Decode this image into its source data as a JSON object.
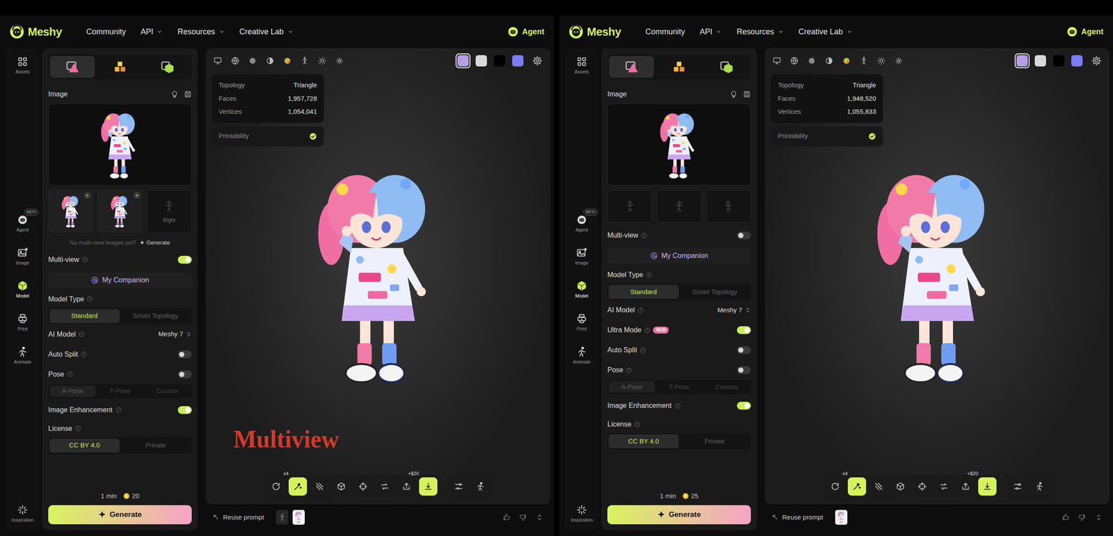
{
  "apps": [
    {
      "nav": {
        "logo": "Meshy",
        "links": [
          {
            "label": "Community",
            "dropdown": false
          },
          {
            "label": "API",
            "dropdown": true
          },
          {
            "label": "Resources",
            "dropdown": true
          },
          {
            "label": "Creative Lab",
            "dropdown": true
          }
        ],
        "agent": "Agent"
      },
      "rail": {
        "top": [
          {
            "label": "Assets",
            "selected": false
          }
        ],
        "middle": [
          {
            "label": "Agent",
            "badge": "BETA",
            "selected": false
          },
          {
            "label": "Image",
            "selected": false
          },
          {
            "label": "Model",
            "selected": true
          },
          {
            "label": "Print",
            "selected": false
          },
          {
            "label": "Animate",
            "selected": false
          }
        ],
        "bottom": [
          {
            "label": "Inspiration",
            "selected": false
          }
        ]
      },
      "settings": {
        "tabs": [
          {
            "selected": true
          },
          {
            "selected": false
          },
          {
            "selected": false
          }
        ],
        "image_label": "Image",
        "thumbs": [
          {
            "kind": "image",
            "removable": true
          },
          {
            "kind": "image",
            "removable": true
          },
          {
            "kind": "placeholder",
            "label": "Right"
          }
        ],
        "hint": {
          "text": "No multi-view images yet?",
          "action": "Generate"
        },
        "rows": [
          {
            "kind": "toggle",
            "label": "Multi-view",
            "info": true,
            "on": true
          },
          {
            "kind": "button",
            "label": "My Companion"
          },
          {
            "kind": "segmented",
            "label": "Model Type",
            "info": true,
            "disabled": false,
            "options": [
              {
                "label": "Standard",
                "selected": true
              },
              {
                "label": "Smart Topology",
                "selected": false
              }
            ]
          },
          {
            "kind": "select",
            "label": "AI Model",
            "info": true,
            "value": "Meshy 7"
          },
          {
            "kind": "toggle",
            "label": "Auto Split",
            "info": true,
            "on": false
          },
          {
            "kind": "toggle",
            "label": "Pose",
            "info": true,
            "on": false
          },
          {
            "kind": "segmented",
            "disabled": true,
            "options": [
              {
                "label": "A-Pose",
                "selected": true
              },
              {
                "label": "T-Pose",
                "selected": false
              },
              {
                "label": "Custom",
                "selected": false
              }
            ]
          },
          {
            "kind": "toggle",
            "label": "Image Enhancement",
            "info": true,
            "on": true
          },
          {
            "kind": "segmented",
            "label": "License",
            "info": true,
            "disabled": false,
            "options": [
              {
                "label": "CC BY 4.0",
                "selected": true
              },
              {
                "label": "Private",
                "selected": false
              }
            ]
          }
        ],
        "footer": {
          "time": "1 min",
          "credits": "20",
          "button": "Generate"
        }
      },
      "viewport": {
        "swatches": [
          {
            "color": "#b79ee6",
            "selected": true
          },
          {
            "color": "#d9d9d9",
            "selected": false
          },
          {
            "color": "#000000",
            "selected": false
          },
          {
            "color": "#7b7cf5",
            "selected": false
          }
        ],
        "stats": [
          {
            "label": "Topology",
            "value": "Triangle"
          },
          {
            "label": "Faces",
            "value": "1,957,728"
          },
          {
            "label": "Vertices",
            "value": "1,054,041"
          }
        ],
        "printability": {
          "label": "Printability",
          "ok": true
        },
        "annotation": "Multiview",
        "tools": [
          {
            "badge": "x4",
            "selected": false
          },
          {
            "selected": true
          },
          {
            "selected": false
          },
          {
            "selected": false
          },
          {
            "selected": false
          },
          {
            "selected": false
          },
          {
            "badge": "+$20",
            "selected": false
          },
          {
            "selected": true
          }
        ],
        "extra_tools": [
          {
            "selected": false
          },
          {
            "selected": false
          }
        ],
        "prompt": {
          "label": "Reuse prompt",
          "thumbs": [
            {
              "kind": "icon"
            },
            {
              "kind": "image"
            }
          ]
        }
      }
    },
    {
      "nav": {
        "logo": "Meshy",
        "links": [
          {
            "label": "Community",
            "dropdown": false
          },
          {
            "label": "API",
            "dropdown": true
          },
          {
            "label": "Resources",
            "dropdown": true
          },
          {
            "label": "Creative Lab",
            "dropdown": true
          }
        ],
        "agent": "Agent"
      },
      "rail": {
        "top": [
          {
            "label": "Assets",
            "selected": false
          }
        ],
        "middle": [
          {
            "label": "Agent",
            "badge": "BETA",
            "selected": false
          },
          {
            "label": "Image",
            "selected": false
          },
          {
            "label": "Model",
            "selected": true
          },
          {
            "label": "Print",
            "selected": false
          },
          {
            "label": "Animate",
            "selected": false
          }
        ],
        "bottom": [
          {
            "label": "Inspiration",
            "selected": false
          }
        ]
      },
      "settings": {
        "tabs": [
          {
            "selected": true
          },
          {
            "selected": false
          },
          {
            "selected": false
          }
        ],
        "image_label": "Image",
        "thumbs": [
          {
            "kind": "placeholder"
          },
          {
            "kind": "placeholder"
          },
          {
            "kind": "placeholder"
          }
        ],
        "rows": [
          {
            "kind": "toggle",
            "label": "Multi-view",
            "info": true,
            "on": false
          },
          {
            "kind": "button",
            "label": "My Companion"
          },
          {
            "kind": "segmented",
            "label": "Model Type",
            "info": true,
            "disabled": false,
            "options": [
              {
                "label": "Standard",
                "selected": true
              },
              {
                "label": "Smart Topology",
                "selected": false
              }
            ]
          },
          {
            "kind": "select",
            "label": "AI Model",
            "info": true,
            "value": "Meshy 7"
          },
          {
            "kind": "toggle",
            "label": "Ultra Mode",
            "info": true,
            "badge": "NEW",
            "on": true
          },
          {
            "kind": "toggle",
            "label": "Auto Split",
            "info": true,
            "on": false
          },
          {
            "kind": "toggle",
            "label": "Pose",
            "info": true,
            "on": false
          },
          {
            "kind": "segmented",
            "disabled": true,
            "options": [
              {
                "label": "A-Pose",
                "selected": true
              },
              {
                "label": "T-Pose",
                "selected": false
              },
              {
                "label": "Custom",
                "selected": false
              }
            ]
          },
          {
            "kind": "toggle",
            "label": "Image Enhancement",
            "info": true,
            "on": true
          },
          {
            "kind": "segmented",
            "label": "License",
            "info": true,
            "disabled": false,
            "options": [
              {
                "label": "CC BY 4.0",
                "selected": true
              },
              {
                "label": "Private",
                "selected": false
              }
            ]
          }
        ],
        "footer": {
          "time": "1 min",
          "credits": "25",
          "button": "Generate"
        }
      },
      "viewport": {
        "swatches": [
          {
            "color": "#b79ee6",
            "selected": true
          },
          {
            "color": "#d9d9d9",
            "selected": false
          },
          {
            "color": "#000000",
            "selected": false
          },
          {
            "color": "#7b7cf5",
            "selected": false
          }
        ],
        "stats": [
          {
            "label": "Topology",
            "value": "Triangle"
          },
          {
            "label": "Faces",
            "value": "1,948,520"
          },
          {
            "label": "Vertices",
            "value": "1,055,833"
          }
        ],
        "printability": {
          "label": "Printability",
          "ok": true
        },
        "tools": [
          {
            "badge": "x4",
            "selected": false
          },
          {
            "selected": true
          },
          {
            "selected": false
          },
          {
            "selected": false
          },
          {
            "selected": false
          },
          {
            "selected": false
          },
          {
            "badge": "+$20",
            "selected": false
          },
          {
            "selected": true
          }
        ],
        "extra_tools": [
          {
            "selected": false
          },
          {
            "selected": false
          }
        ],
        "prompt": {
          "label": "Reuse prompt",
          "thumbs": [
            {
              "kind": "image"
            }
          ]
        }
      }
    }
  ]
}
